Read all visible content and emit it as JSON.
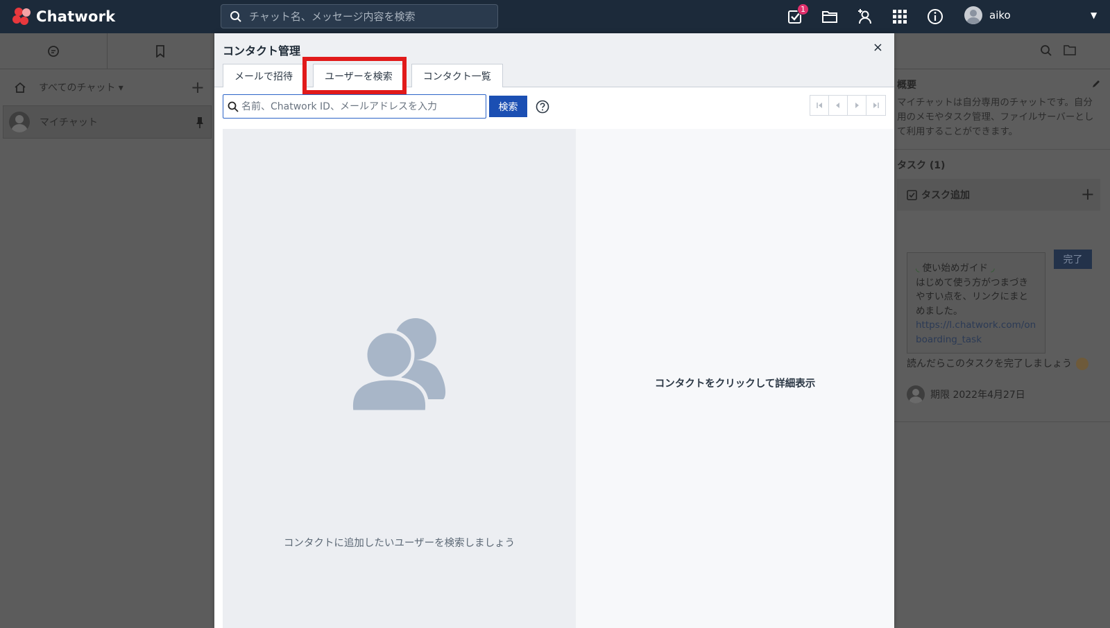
{
  "app": {
    "name": "Chatwork"
  },
  "topbar": {
    "search_placeholder": "チャット名、メッセージ内容を検索",
    "task_badge": "1",
    "user_name": "aiko"
  },
  "sidebar": {
    "filter_label": "すべてのチャット ▾",
    "chats": [
      {
        "name": "マイチャット"
      }
    ]
  },
  "right_panel": {
    "overview_heading": "概要",
    "overview_desc": "マイチャットは自分専用のチャットです。自分用のメモやタスク管理、ファイルサーバーとして利用することができます。",
    "tasks_heading": "タスク (1)",
    "task_add_label": "タスク追加",
    "guide_title": "使い始めガイド",
    "guide_body": "はじめて使う方がつまづきやすい点を、リンクにまとめました。",
    "guide_link": "https://l.chatwork.com/onboarding_task",
    "done_button": "完了",
    "after_text": "読んだらこのタスクを完了しましょう",
    "deadline": "期限 2022年4月27日"
  },
  "modal": {
    "title": "コンタクト管理",
    "close": "×",
    "tabs": [
      {
        "label": "メールで招待"
      },
      {
        "label": "ユーザーを検索"
      },
      {
        "label": "コンタクト一覧"
      }
    ],
    "active_tab": "ユーザーを検索",
    "search_placeholder": "名前、Chatwork ID、メールアドレスを入力",
    "search_button": "検索",
    "empty_text": "コンタクトに追加したいユーザーを検索しましょう",
    "detail_text": "コンタクトをクリックして詳細表示"
  },
  "colors": {
    "topbar_bg": "#1c2a3a",
    "primary_button": "#1b4fb3",
    "highlight": "#e11a1a",
    "illustration": "#a8b6c8"
  }
}
